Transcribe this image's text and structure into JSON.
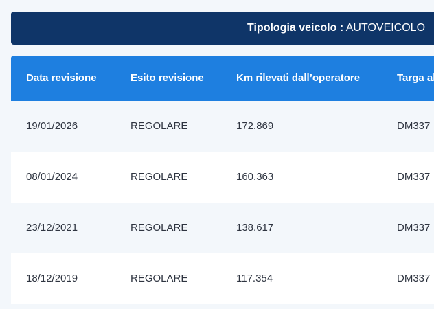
{
  "vehicle": {
    "label": "Tipologia veicolo :",
    "value": "AUTOVEICOLO"
  },
  "table": {
    "headers": [
      "Data revisione",
      "Esito revisione",
      "Km rilevati dall’operatore",
      "Targa al"
    ],
    "rows": [
      [
        "19/01/2026",
        "REGOLARE",
        "172.869",
        "DM337"
      ],
      [
        "08/01/2024",
        "REGOLARE",
        "160.363",
        "DM337"
      ],
      [
        "23/12/2021",
        "REGOLARE",
        "138.617",
        "DM337"
      ],
      [
        "18/12/2019",
        "REGOLARE",
        "117.354",
        "DM337"
      ]
    ]
  },
  "colors": {
    "header_bar": "#0f3568",
    "table_header": "#1e7fe0",
    "text": "#2e3440"
  }
}
